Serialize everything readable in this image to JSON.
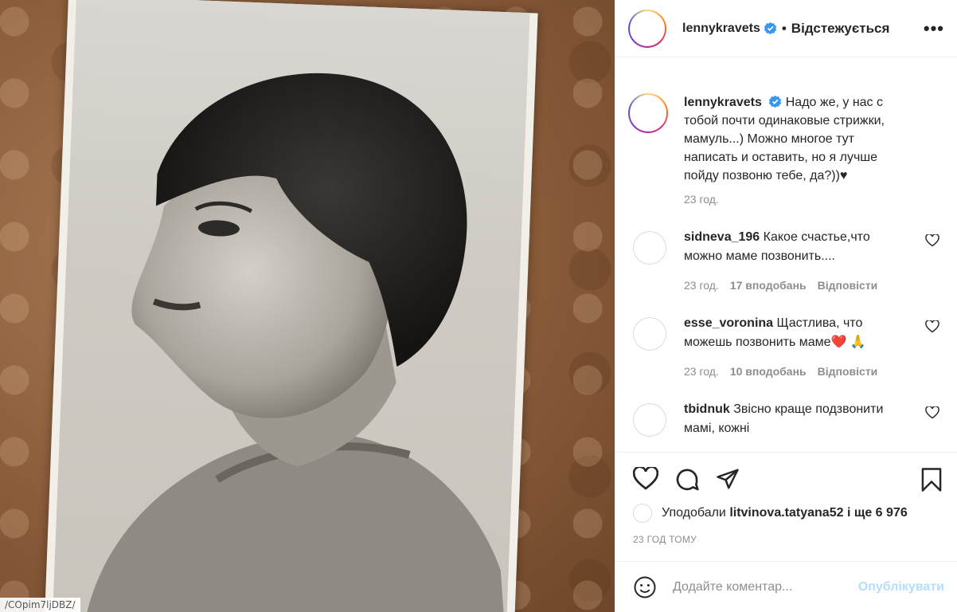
{
  "photo": {
    "file_label": "/COpim7ljDBZ/"
  },
  "header": {
    "username": "lennykravets",
    "separator": "•",
    "follow_status": "Відстежується",
    "more": "•••"
  },
  "caption": {
    "username": "lennykravets",
    "text": "Надо же, у нас с тобой почти одинаковые стрижки, мамуль...) Можно многое тут написать и оставить, но я лучше пойду позвоню тебе, да?))♥",
    "time": "23 год."
  },
  "comments": [
    {
      "username": "sidneva_196",
      "text": "Какое счастье,что можно маме позвонить....",
      "time": "23 год.",
      "likes": "17 вподобань",
      "reply": "Відповісти"
    },
    {
      "username": "esse_voronina",
      "text": "Щастлива, что можешь позвонить маме❤️ 🙏",
      "time": "23 год.",
      "likes": "10 вподобань",
      "reply": "Відповісти"
    },
    {
      "username": "tbidnuk",
      "text": "Звісно краще подзвонити мамі, кожні",
      "time": "",
      "likes": "",
      "reply": ""
    }
  ],
  "likes": {
    "prefix": "Уподобали",
    "user": "litvinova.tatyana52",
    "suffix": "і ще 6 976"
  },
  "posted_ago": "23 ГОД ТОМУ",
  "comment_box": {
    "placeholder": "Додайте коментар...",
    "publish_label": "Опублікувати"
  },
  "colors": {
    "verified": "#3897f0",
    "publish_disabled": "#b2dffc",
    "meta": "#8e8e8e"
  }
}
